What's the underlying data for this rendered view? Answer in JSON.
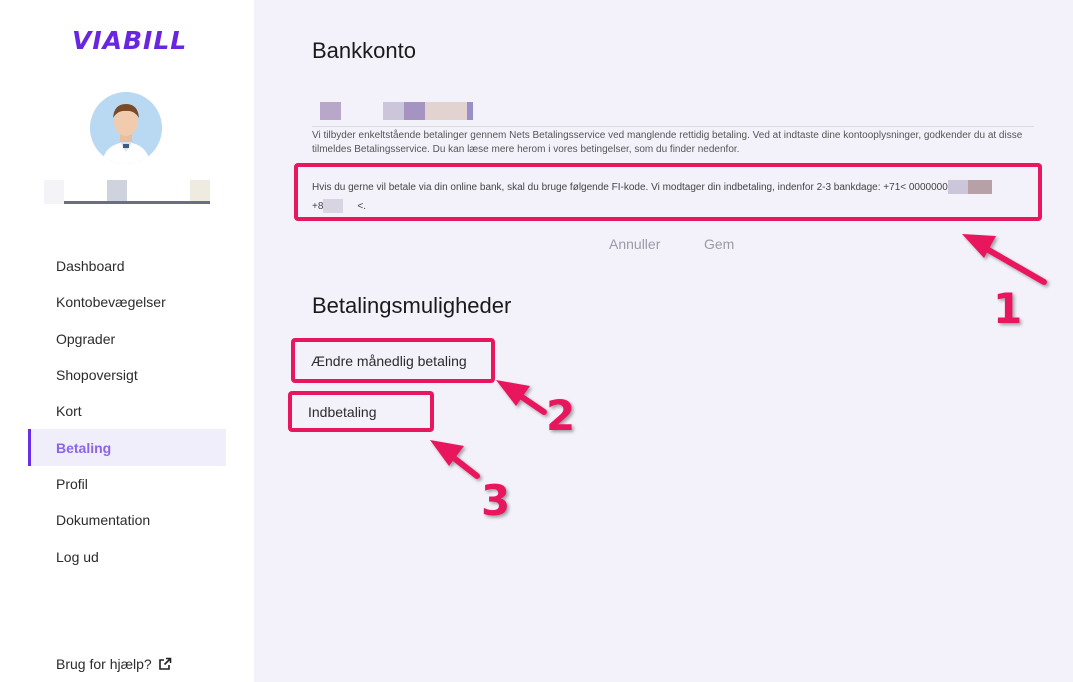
{
  "sidebar": {
    "logo_text": "VIABILL",
    "nav": [
      {
        "label": "Dashboard"
      },
      {
        "label": "Kontobevægelser"
      },
      {
        "label": "Opgrader"
      },
      {
        "label": "Shopoversigt"
      },
      {
        "label": "Kort"
      },
      {
        "label": "Betaling"
      },
      {
        "label": "Profil"
      },
      {
        "label": "Dokumentation"
      },
      {
        "label": "Log ud"
      }
    ],
    "help_label": "Brug for hjælp?"
  },
  "main": {
    "bank_title": "Bankkonto",
    "info_text": "Vi tilbyder enkeltstående betalinger gennem Nets Betalingsservice ved manglende rettidig betaling. Ved at indtaste dine kontooplysninger, godkender du at disse tilmeldes Betalingsservice. Du kan læse mere herom i vores betingelser, som du finder nedenfor.",
    "fi_text_a": "Hvis du gerne vil betale via din online bank, skal du bruge følgende FI-kode. Vi modtager din indbetaling, indenfor 2-3 bankdage: +71< 0000000",
    "fi_text_b": "+8",
    "fi_text_c": "<.",
    "cancel_label": "Annuller",
    "save_label": "Gem",
    "payment_title": "Betalingsmuligheder",
    "change_monthly_label": "Ændre månedlig betaling",
    "deposit_label": "Indbetaling"
  },
  "annotations": [
    "1",
    "2",
    "3"
  ],
  "colors": {
    "accent": "#6a25e0",
    "highlight": "#e8175d",
    "active_bg": "#f0eefa"
  }
}
